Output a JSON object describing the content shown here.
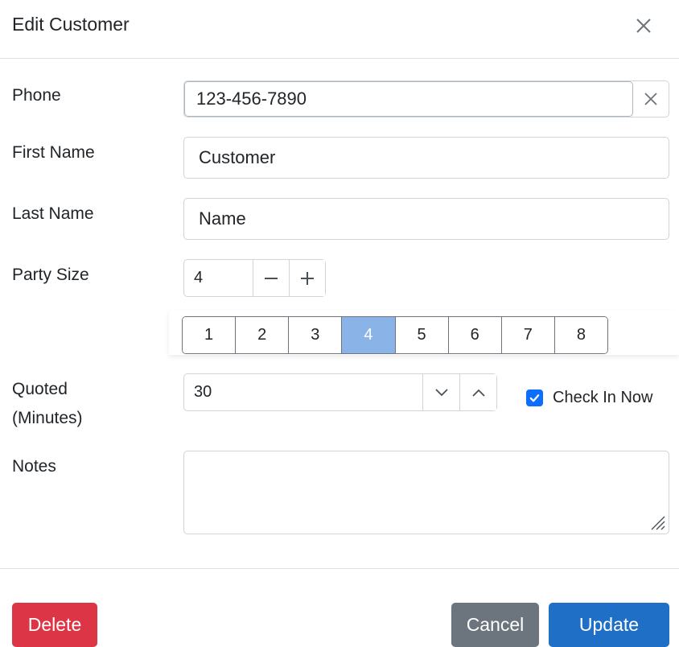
{
  "modal": {
    "title": "Edit Customer"
  },
  "form": {
    "phone": {
      "label": "Phone",
      "value": "123-456-7890"
    },
    "first_name": {
      "label": "First Name",
      "value": "Customer"
    },
    "last_name": {
      "label": "Last Name",
      "value": "Name"
    },
    "party_size": {
      "label": "Party Size",
      "value": "4",
      "options": [
        "1",
        "2",
        "3",
        "4",
        "5",
        "6",
        "7",
        "8"
      ],
      "selected": "4"
    },
    "quoted": {
      "label_line1": "Quoted",
      "label_line2": "(Minutes)",
      "value": "30"
    },
    "check_in": {
      "label": "Check In Now",
      "checked": true
    },
    "notes": {
      "label": "Notes",
      "value": ""
    }
  },
  "footer": {
    "delete_label": "Delete",
    "cancel_label": "Cancel",
    "update_label": "Update"
  },
  "colors": {
    "danger": "#dc3545",
    "secondary": "#6c757d",
    "primary": "#1f6fc6",
    "selected_size": "#8ab4e8",
    "checkbox": "#0d6efd"
  },
  "icons": {
    "close": "close-icon",
    "clear": "clear-icon",
    "minus": "minus-icon",
    "plus": "plus-icon",
    "down": "chevron-down-icon",
    "up": "chevron-up-icon",
    "check": "check-icon"
  }
}
